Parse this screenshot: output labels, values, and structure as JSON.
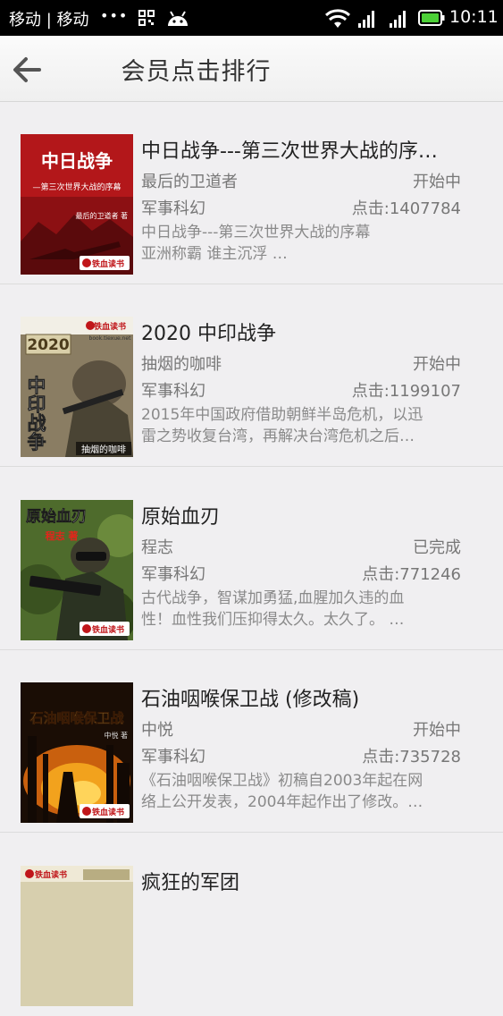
{
  "status_bar": {
    "carrier": "移动 | 移动",
    "dots": "•••",
    "time": "10:11",
    "icons": [
      "grid-icon",
      "android-icon",
      "wifi-icon",
      "signal-icon",
      "signal-icon",
      "battery-icon"
    ],
    "battery_color": "#4cd137"
  },
  "header": {
    "title": "会员点击排行",
    "back_icon": "arrow-left-icon"
  },
  "books": [
    {
      "title": "中日战争---第三次世界大战的序…",
      "author": "最后的卫道者",
      "status": "开始中",
      "category": "军事科幻",
      "clicks": "点击:1407784",
      "desc_line1": "中日战争---第三次世界大战的序幕",
      "desc_line2": "亚洲称霸 谁主沉浮    …",
      "cover": {
        "title": "中日战争",
        "subtitle": "—第三次世界大战的序幕",
        "author": "最后的卫道者 著",
        "publisher": "铁血读书"
      }
    },
    {
      "title": "2020 中印战争",
      "author": "抽烟的咖啡",
      "status": "开始中",
      "category": "军事科幻",
      "clicks": "点击:1199107",
      "desc_line1": "2015年中国政府借助朝鲜半岛危机，以迅",
      "desc_line2": "雷之势收复台湾，再解决台湾危机之后…",
      "cover": {
        "year": "2020",
        "title": "中印战争",
        "author": "抽烟的咖啡",
        "publisher": "铁血读书",
        "site": "book.tiexue.net"
      }
    },
    {
      "title": "原始血刃",
      "author": "程志",
      "status": "已完成",
      "category": "军事科幻",
      "clicks": "点击:771246",
      "desc_line1": "古代战争，智谋加勇猛,血腥加久违的血",
      "desc_line2": "性！血性我们压抑得太久。太久了。 …",
      "cover": {
        "title": "原始血刃",
        "author": "程志 著",
        "publisher": "铁血读书"
      }
    },
    {
      "title": "石油咽喉保卫战 (修改稿)",
      "author": "中悦",
      "status": "开始中",
      "category": "军事科幻",
      "clicks": "点击:735728",
      "desc_line1": "《石油咽喉保卫战》初稿自2003年起在网",
      "desc_line2": "络上公开发表，2004年起作出了修改。…",
      "cover": {
        "title": "石油咽喉保卫战",
        "author": "中悦 著",
        "publisher": "铁血读书"
      }
    },
    {
      "title": "疯狂的军团",
      "author": "",
      "status": "",
      "category": "",
      "clicks": "",
      "desc_line1": "",
      "desc_line2": "",
      "cover": {
        "publisher": "铁血读书"
      }
    }
  ]
}
